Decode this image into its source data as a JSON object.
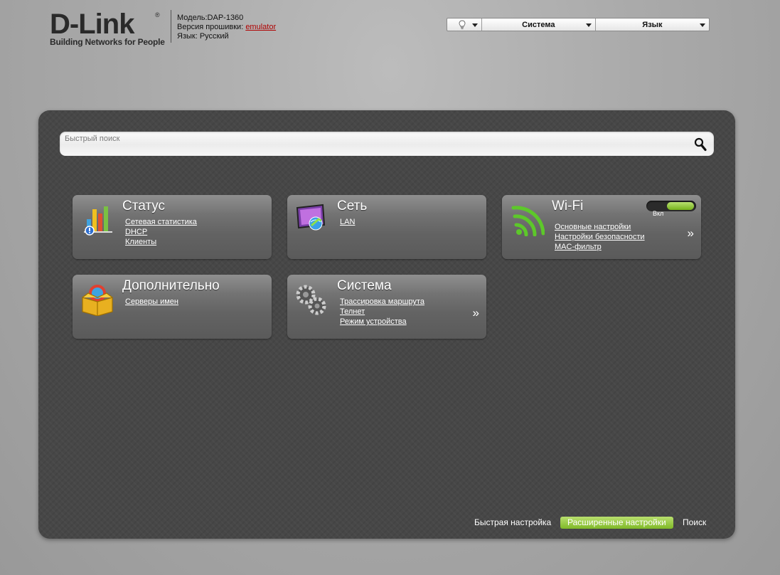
{
  "header": {
    "logo_word": "D-Link",
    "logo_reg": "®",
    "logo_tagline": "Building Networks for People",
    "model": "Модель:DAP-1360",
    "firmware_label": "Версия прошивки: ",
    "firmware_link": "emulator",
    "language": "Язык: Русский"
  },
  "topbar": {
    "hint_icon": "lightbulb-icon",
    "system": "Система",
    "language": "Язык"
  },
  "search": {
    "placeholder": "Быстрый поиск",
    "icon": "magnifier-icon"
  },
  "tiles": [
    {
      "title": "Статус",
      "icon": "status-bars-icon",
      "links": [
        "Сетевая статистика",
        "DHCP",
        "Клиенты"
      ]
    },
    {
      "title": "Сеть",
      "icon": "network-monitor-icon",
      "links": [
        "LAN"
      ]
    },
    {
      "title": "Wi-Fi",
      "icon": "wifi-icon",
      "links": [
        "Основные настройки",
        "Настройки безопасности",
        "MAC-фильтр"
      ],
      "toggle_label": "Вкл",
      "toggle_on": true,
      "more": "»"
    },
    {
      "title": "Дополнительно",
      "icon": "box-icon",
      "links": [
        "Серверы имен"
      ]
    },
    {
      "title": "Система",
      "icon": "gears-icon",
      "links": [
        "Трассировка маршрута",
        "Телнет",
        "Режим устройства"
      ],
      "more": "»"
    }
  ],
  "footer": {
    "quick_setup": "Быстрая настройка",
    "advanced_setup": "Расширенные настройки",
    "search": "Поиск"
  },
  "colors": {
    "panel": "#474747",
    "accent_green": "#8cc63f",
    "firmware_link": "#b00000"
  }
}
